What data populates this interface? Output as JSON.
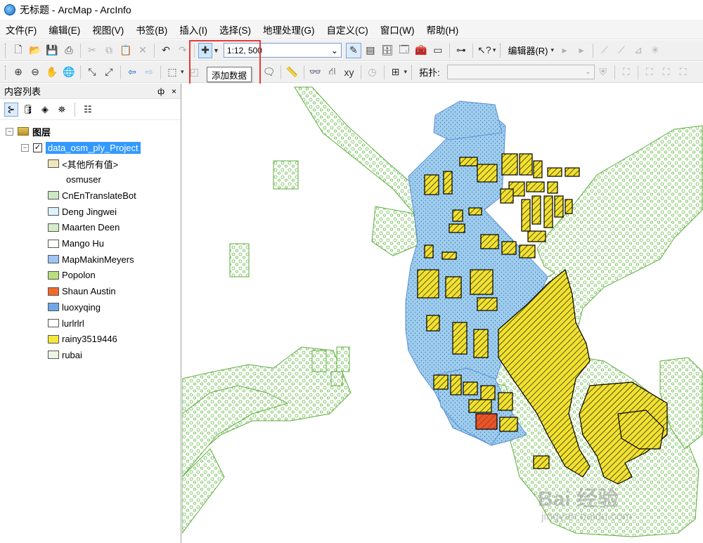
{
  "window": {
    "title": "无标题 - ArcMap - ArcInfo"
  },
  "menu": [
    "文件(F)",
    "编辑(E)",
    "视图(V)",
    "书签(B)",
    "插入(I)",
    "选择(S)",
    "地理处理(G)",
    "自定义(C)",
    "窗口(W)",
    "帮助(H)"
  ],
  "toolbar": {
    "scale_value": "1:12, 500",
    "editor_label": "编辑器(R)",
    "topology_label": "拓扑:",
    "tooltip": "添加数据"
  },
  "toc": {
    "title": "内容列表",
    "pin": "ф",
    "close": "×",
    "layers_root": "图层",
    "layer_name": "data_osm_ply_Project",
    "layer_checked": "✓",
    "legend": [
      {
        "label": "<其他所有值>",
        "color": "#f2e6bd"
      },
      {
        "label": "osmuser"
      },
      {
        "label": "CnEnTranslateBot",
        "color": "#cde8c2"
      },
      {
        "label": "Deng Jingwei",
        "color": "#dff1fb"
      },
      {
        "label": "Maarten Deen",
        "color": "#d5ecc8"
      },
      {
        "label": "Mango Hu",
        "color": "#ffffff"
      },
      {
        "label": "MapMakinMeyers",
        "color": "#9ec5f5"
      },
      {
        "label": "Popolon",
        "color": "#b9e07c"
      },
      {
        "label": "Shaun Austin",
        "color": "#f06a2a"
      },
      {
        "label": "luoxyqing",
        "color": "#6fa8e8"
      },
      {
        "label": "lurlrlrl",
        "color": "#ffffff"
      },
      {
        "label": "rainy3519446",
        "color": "#f5e83a"
      },
      {
        "label": "rubai",
        "color": "#eaf6e3"
      }
    ]
  },
  "map": {
    "colors": {
      "water": "#9fcbf5",
      "water_edge": "#5b8fd6",
      "green_edge": "#5fae3f",
      "building": "#f2e12e",
      "building_alt": "#e8552a"
    }
  },
  "watermark": {
    "main": "Bai 经验",
    "sub": "jingyan.baidu.com"
  }
}
